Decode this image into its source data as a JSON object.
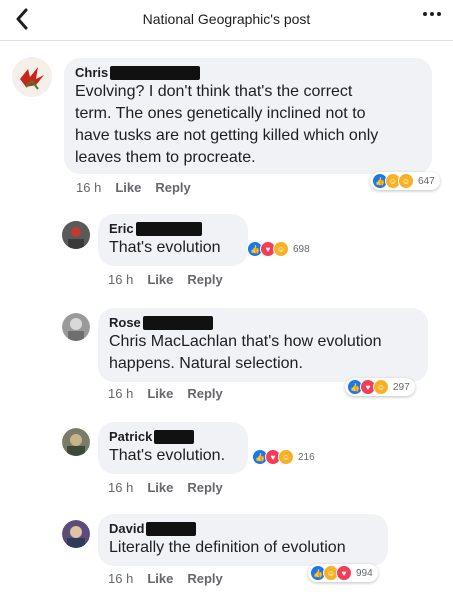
{
  "header": {
    "title": "National Geographic's post",
    "back_icon": "chevron-left-icon",
    "more_icon": "ellipsis-icon"
  },
  "comments": [
    {
      "name": "Chris",
      "text_lines": [
        "Evolving?  I don't think that's the correct",
        "term.  The ones genetically inclined not to",
        "have tusks are not getting killed which only",
        "leaves them to procreate."
      ],
      "time": "16 h",
      "like_label": "Like",
      "reply_label": "Reply",
      "reactions": [
        "like",
        "haha",
        "wow"
      ],
      "count": "647"
    },
    {
      "name": "Eric",
      "text_lines": [
        "That's evolution"
      ],
      "time": "16 h",
      "like_label": "Like",
      "reply_label": "Reply",
      "reactions": [
        "like",
        "love",
        "haha"
      ],
      "count": "698"
    },
    {
      "name": "Rose",
      "text_lines": [
        "Chris MacLachlan that's how evolution",
        "happens. Natural selection."
      ],
      "time": "16 h",
      "like_label": "Like",
      "reply_label": "Reply",
      "reactions": [
        "like",
        "love",
        "haha"
      ],
      "count": "297"
    },
    {
      "name": "Patrick",
      "text_lines": [
        "That's evolution."
      ],
      "time": "16 h",
      "like_label": "Like",
      "reply_label": "Reply",
      "reactions": [
        "like",
        "love",
        "haha"
      ],
      "count": "216"
    },
    {
      "name": "David",
      "text_lines": [
        "Literally the definition of evolution"
      ],
      "time": "16 h",
      "like_label": "Like",
      "reply_label": "Reply",
      "reactions": [
        "like",
        "haha",
        "love"
      ],
      "count": "994"
    }
  ],
  "colors": {
    "like": "#1877f2",
    "love": "#f33e58",
    "haha": "#f7b125",
    "bubble": "#f0f2f5",
    "meta": "#65676b"
  }
}
